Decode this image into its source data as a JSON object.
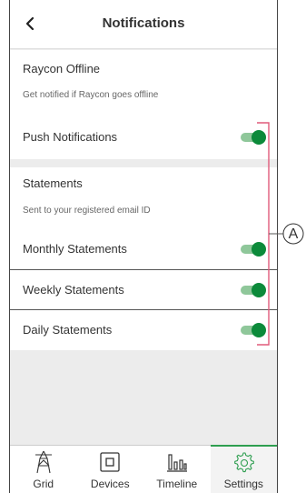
{
  "header": {
    "title": "Notifications",
    "back_icon": "chevron-left-icon"
  },
  "raycon": {
    "title": "Raycon Offline",
    "description": "Get notified if Raycon goes offline",
    "push": {
      "label": "Push Notifications",
      "enabled": true
    }
  },
  "statements": {
    "title": "Statements",
    "description": "Sent to your registered email ID",
    "items": [
      {
        "label": "Monthly Statements",
        "enabled": true
      },
      {
        "label": "Weekly Statements",
        "enabled": true
      },
      {
        "label": "Daily Statements",
        "enabled": true
      }
    ]
  },
  "tabs": [
    {
      "label": "Grid",
      "icon": "grid-tower-icon",
      "active": false
    },
    {
      "label": "Devices",
      "icon": "devices-icon",
      "active": false
    },
    {
      "label": "Timeline",
      "icon": "timeline-icon",
      "active": false
    },
    {
      "label": "Settings",
      "icon": "gear-icon",
      "active": true
    }
  ],
  "callout": {
    "label": "A"
  },
  "colors": {
    "toggle_on": "#0c8a3a",
    "toggle_track": "#8fc79a",
    "active_tab": "#2e9e50"
  }
}
